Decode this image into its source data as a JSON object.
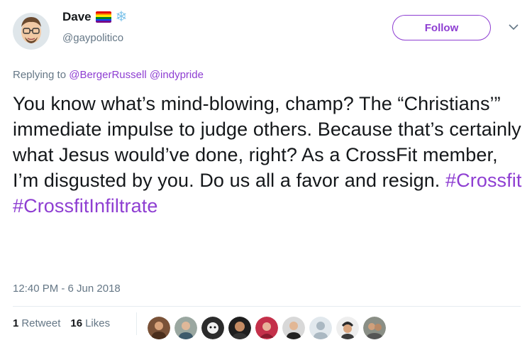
{
  "user": {
    "display_name": "Dave",
    "handle": "@gaypolitico",
    "badges": [
      "rainbow-flag-icon",
      "snowflake-icon"
    ]
  },
  "follow_button": {
    "label": "Follow"
  },
  "reply": {
    "prefix": "Replying to ",
    "mention_1": "@BergerRussell",
    "mention_2": "@indypride"
  },
  "tweet": {
    "body": "You know what’s mind-blowing, champ? The “Christians’” immediate impulse to judge others. Because that’s certainly what Jesus would’ve done, right? As a CrossFit member, I’m disgusted by you. Do us all a favor and resign. ",
    "hashtag_1": "#Crossfit",
    "hashtag_2": "#CrossfitInfiltrate",
    "timestamp": "12:40 PM - 6 Jun 2018"
  },
  "stats": {
    "retweets_count": "1",
    "retweets_label": "Retweet",
    "likes_count": "16",
    "likes_label": "Likes"
  },
  "colors": {
    "accent": "#8e3ed2",
    "secondary_text": "#657786"
  }
}
